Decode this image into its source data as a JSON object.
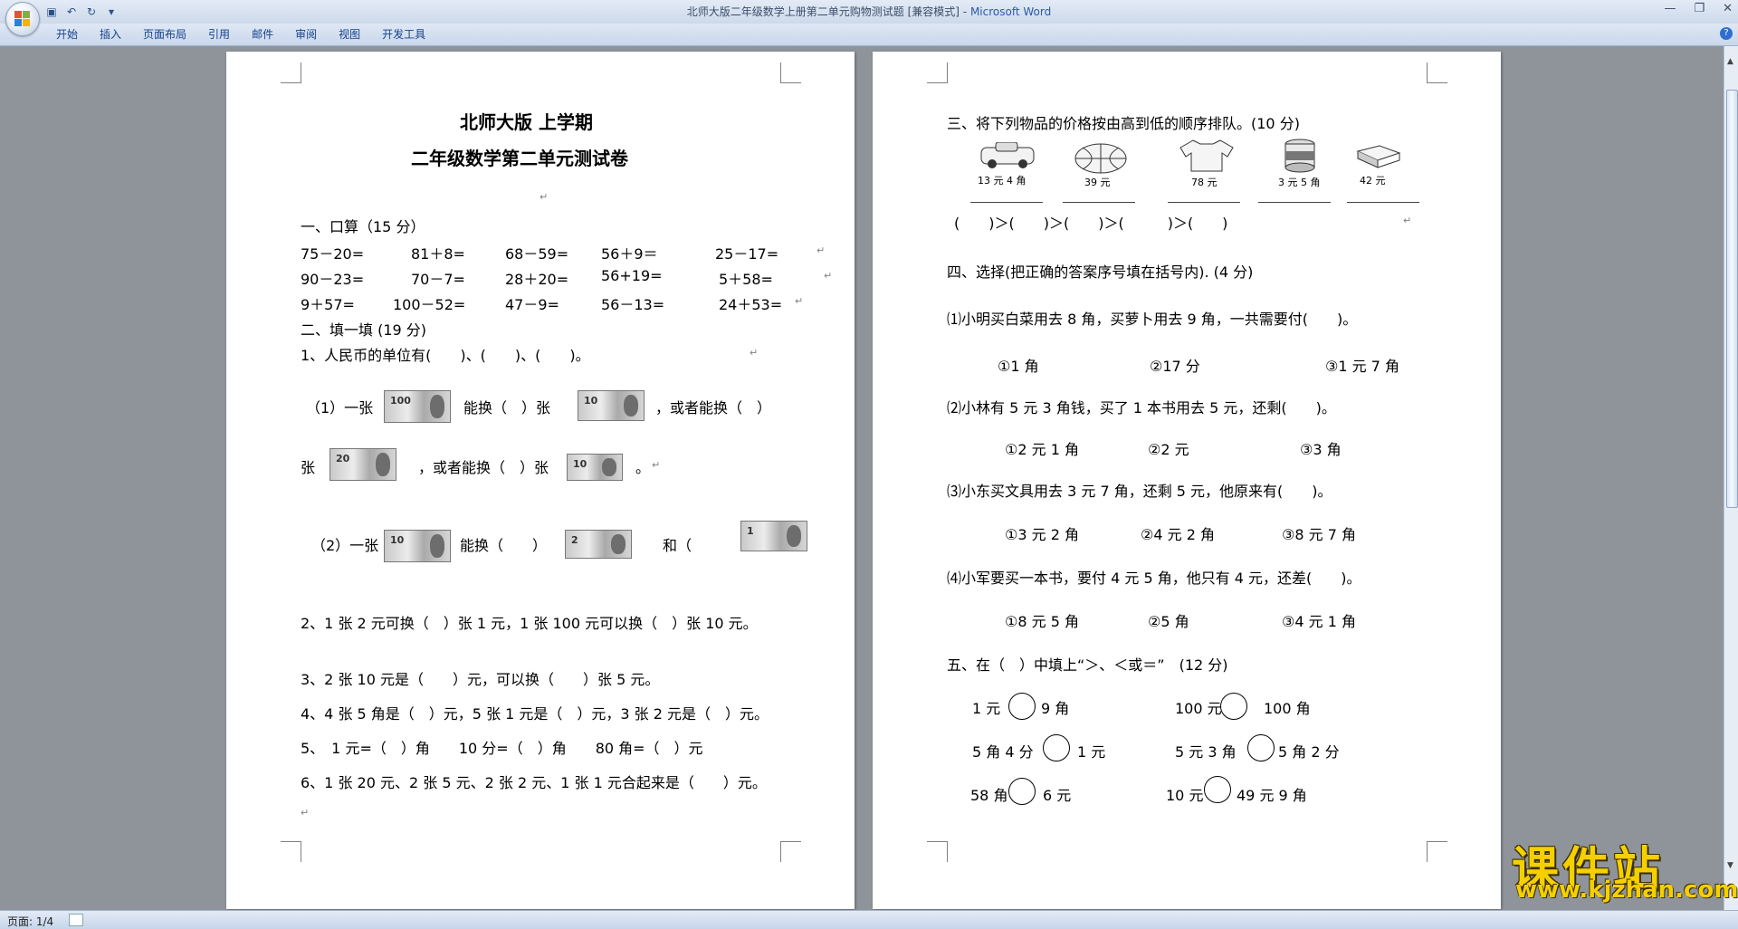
{
  "window": {
    "title_doc": "北师大版二年级数学上册第二单元购物测试题 [兼容模式]",
    "title_sep": " - ",
    "title_app": "Microsoft Word",
    "min": "—",
    "max": "❐",
    "close": "✕"
  },
  "ribbon": {
    "tabs": [
      "开始",
      "插入",
      "页面布局",
      "引用",
      "邮件",
      "审阅",
      "视图",
      "开发工具"
    ],
    "help": "?"
  },
  "status": {
    "page": "页面: 1/4"
  },
  "marks": {
    "para": "↵"
  },
  "page1": {
    "title1": "北师大版  上学期",
    "title2": "二年级数学第二单元测试卷",
    "s1": "一、口算（15 分）",
    "calc_rows": [
      [
        "75－20=",
        "81＋8=",
        "68－59=",
        "56＋9＝",
        "25－17="
      ],
      [
        "90－23=",
        "70－7=",
        "28＋20=",
        "56+19=",
        "5＋58="
      ],
      [
        "9＋57=",
        "100－52=",
        "47－9=",
        "56－13=",
        "24＋53="
      ]
    ],
    "s2": "二、填一填 (19 分)",
    "q1": "1、人民币的单位有(　　)、(　　)、(　　)。",
    "q1a_1": "（1）一张",
    "q1a_2": "能换（　）张",
    "q1a_3": "，或者能换（　）",
    "q1b_1": "张",
    "q1b_2": "，或者能换（　）张",
    "q1b_3": "。",
    "q1c_1": "（2）一张",
    "q1c_2": "能换（　　）",
    "q1c_3": "和（",
    "notes": [
      "100",
      "10",
      "20",
      "10",
      "10",
      "2",
      "1"
    ],
    "q2": "2、1 张 2 元可换（　）张 1 元，1 张 100 元可以换（　）张 10 元。",
    "q3": "3、2 张 10 元是（　　）元，可以换（　　）张 5 元。",
    "q4": "4、4 张 5 角是（　）元，5 张 1 元是（　）元，3 张 2 元是（　）元。",
    "q5": "5、　1 元=（　）角　　10 分=（　）角　　80 角=（　）元",
    "q6": "6、1 张 20 元、2 张 5 元、2 张 2 元、1 张 1 元合起来是（　　）元。"
  },
  "page2": {
    "s3": "三、将下列物品的价格按由高到低的顺序排队。(10 分)",
    "items": [
      {
        "icon": "toy-car-icon",
        "price": "13 元 4 角"
      },
      {
        "icon": "basketball-icon",
        "price": "39 元"
      },
      {
        "icon": "shirt-icon",
        "price": "78 元"
      },
      {
        "icon": "can-icon",
        "price": "3 元 5 角"
      },
      {
        "icon": "book-icon",
        "price": "42 元"
      }
    ],
    "order": "(　　)＞(　　)＞(　　)＞(　　　)＞(　　)",
    "s4": "四、选择(把正确的答案序号填在括号内). (4 分)",
    "c1": "⑴小明买白菜用去 8 角，买萝卜用去 9 角，一共需要付(　　)。",
    "c1o": [
      "①1 角",
      "②17 分",
      "③1 元 7 角"
    ],
    "c2": "⑵小林有 5 元 3 角钱，买了 1 本书用去 5 元，还剩(　　)。",
    "c2o": [
      "①2 元 1 角",
      "②2 元",
      "③3 角"
    ],
    "c3": "⑶小东买文具用去 3 元 7 角，还剩 5 元，他原来有(　　)。",
    "c3o": [
      "①3 元 2 角",
      "②4 元 2 角",
      "③8 元 7 角"
    ],
    "c4": "⑷小军要买一本书，要付 4 元 5 角，他只有 4 元，还差(　　)。",
    "c4o": [
      "①8 元 5 角",
      "②5 角",
      "③4 元 1 角"
    ],
    "s5": "五、在（　）中填上“＞、＜或＝”　(12 分)",
    "cmp": [
      [
        "1 元",
        "9 角",
        "100 元",
        "100 角"
      ],
      [
        "5 角 4 分",
        "1 元",
        "5 元 3 角",
        "5 角 2 分"
      ],
      [
        "58 角",
        "6 元",
        "10 元",
        "49 元 9 角"
      ]
    ]
  },
  "watermark": {
    "cn": "课件站",
    "url": "www.kjzhan.com"
  }
}
